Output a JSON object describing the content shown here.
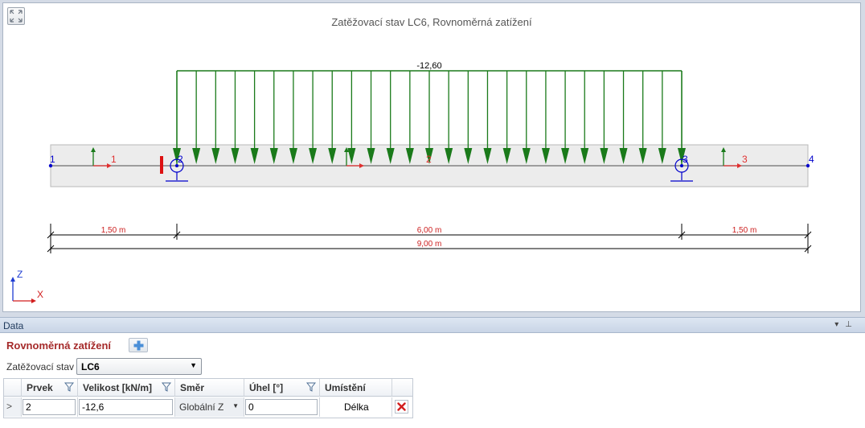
{
  "viewport": {
    "title": "Zatěžovací stav LC6, Rovnoměrná zatížení",
    "load_value": "-12,60",
    "nodes": [
      "1",
      "2",
      "3",
      "4"
    ],
    "members": [
      "1",
      "2",
      "3"
    ],
    "dimensions": {
      "spans": [
        "1,50 m",
        "6,00 m",
        "1,50 m"
      ],
      "total": "9,00 m"
    },
    "axes": {
      "z": "Z",
      "x": "X"
    },
    "colors": {
      "load": "#1a7a1a",
      "dimension_text": "#cc2020",
      "node": "#0000cc",
      "support": "#0000cc",
      "member_label": "#e03030"
    }
  },
  "panel": {
    "title": "Data",
    "section_title": "Rovnoměrná zatížení",
    "load_case_label": "Zatěžovací stav",
    "load_case_value": "LC6",
    "columns": [
      "Prvek",
      "Velikost [kN/m]",
      "Směr",
      "Úhel [°]",
      "Umístění"
    ],
    "rows": [
      {
        "prvek": "2",
        "velikost": "-12,6",
        "smer": "Globální Z",
        "uhel": "0",
        "umisteni": "Délka"
      }
    ]
  }
}
